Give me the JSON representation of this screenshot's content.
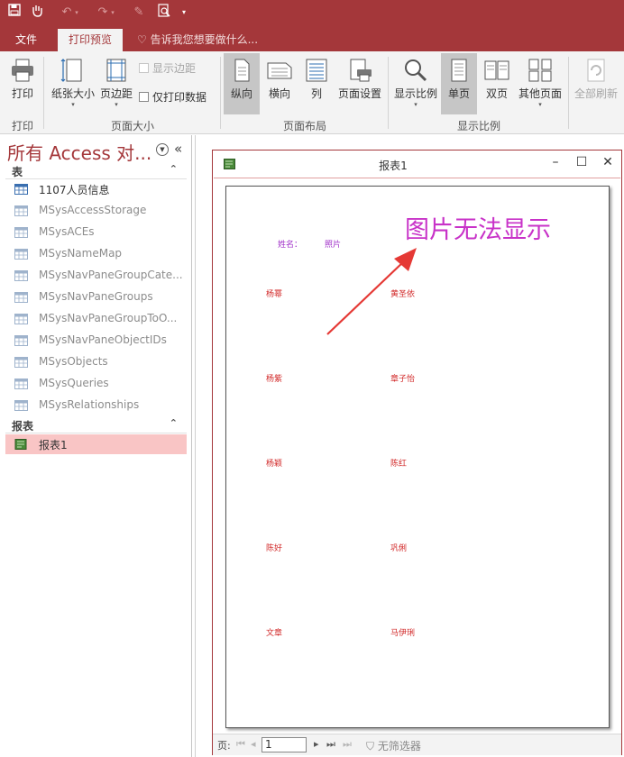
{
  "tabs": {
    "file": "文件",
    "print_preview": "打印预览",
    "tell_me": "告诉我您想要做什么..."
  },
  "ribbon": {
    "print": "打印",
    "paper_size": "纸张大小",
    "margins": "页边距",
    "show_margins": "显示边距",
    "print_data_only": "仅打印数据",
    "portrait": "纵向",
    "landscape": "横向",
    "columns": "列",
    "page_setup": "页面设置",
    "zoom": "显示比例",
    "one_page": "单页",
    "two_pages": "双页",
    "more_pages": "其他页面",
    "refresh_all": "全部刷新",
    "groups": {
      "print": "打印",
      "page_size": "页面大小",
      "page_layout": "页面布局",
      "zoom": "显示比例"
    }
  },
  "nav": {
    "title": "所有 Access 对...",
    "tables_header": "表",
    "tables": [
      "1107人员信息",
      "MSysAccessStorage",
      "MSysACEs",
      "MSysNameMap",
      "MSysNavPaneGroupCate...",
      "MSysNavPaneGroups",
      "MSysNavPaneGroupToO...",
      "MSysNavPaneObjectIDs",
      "MSysObjects",
      "MSysQueries",
      "MSysRelationships"
    ],
    "reports_header": "报表",
    "reports": [
      "报表1"
    ]
  },
  "report": {
    "window_title": "报表1",
    "name_label": "姓名：",
    "photo_label": "照片",
    "annotation": "图片无法显示",
    "rows": [
      {
        "name": "杨幂",
        "photo": "黄圣依"
      },
      {
        "name": "杨紫",
        "photo": "章子怡"
      },
      {
        "name": "杨颖",
        "photo": "陈红"
      },
      {
        "name": "陈好",
        "photo": "巩俐"
      },
      {
        "name": "文章",
        "photo": "马伊琍"
      }
    ]
  },
  "record_nav": {
    "label": "页:",
    "current": "1",
    "filter": "无筛选器"
  },
  "colors": {
    "accent": "#a4373a",
    "annotation": "#c832c8",
    "arrow": "#e53935",
    "field_value": "#d22a2a",
    "field_label": "#a030c8"
  }
}
